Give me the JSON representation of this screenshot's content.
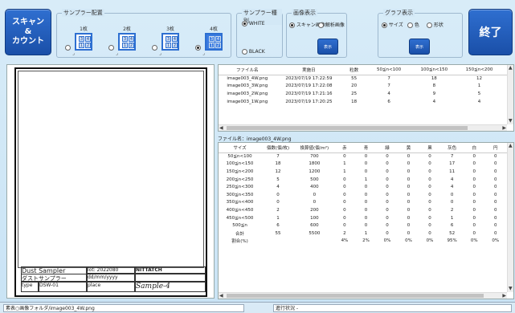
{
  "buttons": {
    "scan": "スキャン\n&\nカウント",
    "exit": "終了",
    "scan_image_view": "表示",
    "graph_view": "表示"
  },
  "sampler_group": {
    "title": "サンプラー配置",
    "options": [
      {
        "label": "1枚",
        "cells": [
          "3",
          "4",
          "1",
          "2"
        ],
        "selected": false
      },
      {
        "label": "2枚",
        "cells": [
          "3",
          "4",
          "1",
          "2"
        ],
        "selected": false
      },
      {
        "label": "3枚",
        "cells": [
          "3",
          "4",
          "1",
          "2"
        ],
        "selected": false
      },
      {
        "label": "4枚",
        "cells": [
          "3",
          "4",
          "1",
          "2"
        ],
        "selected": true
      }
    ],
    "corner_mark": "⌟"
  },
  "background_group": {
    "title": "サンプラー種別",
    "white": "WHITE",
    "black": "BLACK",
    "selected": "WHITE"
  },
  "image_view_group": {
    "title": "画像表示",
    "scan_image": "スキャン画像",
    "analysis_image": "解析画像",
    "selected": "スキャン画像"
  },
  "graph_group": {
    "title": "グラフ表示",
    "size": "サイズ",
    "color": "色",
    "shape": "形状",
    "selected": "サイズ"
  },
  "file_list": {
    "headers": [
      "ファイル名",
      "実施日",
      "粒数",
      "50≦n<100",
      "100≦n<150",
      "150≦n<200"
    ],
    "rows": [
      [
        "image003_4W.png",
        "2023/07/19 17:22:59",
        "55",
        "7",
        "18",
        "12"
      ],
      [
        "image003_3W.png",
        "2023/07/19 17:22:08",
        "20",
        "7",
        "8",
        "1"
      ],
      [
        "image003_2W.png",
        "2023/07/19 17:21:16",
        "25",
        "4",
        "9",
        "5"
      ],
      [
        "image003_1W.png",
        "2023/07/19 17:20:25",
        "18",
        "6",
        "4",
        "4"
      ]
    ]
  },
  "detail": {
    "file_label": "ファイル名：image003_4W.png",
    "headers": [
      "サイズ",
      "個数(個/枚)",
      "換算値(個/m²)",
      "赤",
      "青",
      "緑",
      "黄",
      "黒",
      "灰色",
      "白",
      "円"
    ],
    "rows": [
      [
        "50≦n<100",
        "7",
        "700",
        "0",
        "0",
        "0",
        "0",
        "0",
        "7",
        "0",
        "0"
      ],
      [
        "100≦n<150",
        "18",
        "1800",
        "1",
        "0",
        "0",
        "0",
        "0",
        "17",
        "0",
        "0"
      ],
      [
        "150≦n<200",
        "12",
        "1200",
        "1",
        "0",
        "0",
        "0",
        "0",
        "11",
        "0",
        "0"
      ],
      [
        "200≦n<250",
        "5",
        "500",
        "0",
        "1",
        "0",
        "0",
        "0",
        "4",
        "0",
        "0"
      ],
      [
        "250≦n<300",
        "4",
        "400",
        "0",
        "0",
        "0",
        "0",
        "0",
        "4",
        "0",
        "0"
      ],
      [
        "300≦n<350",
        "0",
        "0",
        "0",
        "0",
        "0",
        "0",
        "0",
        "0",
        "0",
        "0"
      ],
      [
        "350≦n<400",
        "0",
        "0",
        "0",
        "0",
        "0",
        "0",
        "0",
        "0",
        "0",
        "0"
      ],
      [
        "400≦n<450",
        "2",
        "200",
        "0",
        "0",
        "0",
        "0",
        "0",
        "2",
        "0",
        "0"
      ],
      [
        "450≦n<500",
        "1",
        "100",
        "0",
        "0",
        "0",
        "0",
        "0",
        "1",
        "0",
        "0"
      ],
      [
        "500≦n",
        "6",
        "600",
        "0",
        "0",
        "0",
        "0",
        "0",
        "6",
        "0",
        "0"
      ],
      [
        "合計",
        "55",
        "5500",
        "2",
        "1",
        "0",
        "0",
        "0",
        "52",
        "0",
        "0"
      ],
      [
        "割合(%)",
        "",
        "",
        "4%",
        "2%",
        "0%",
        "0%",
        "0%",
        "95%",
        "0%",
        "0%"
      ]
    ]
  },
  "sheet": {
    "title_en": "Dust Sampler",
    "title_jp": "ダストサンプラー",
    "lot_label": "lot:",
    "lot_value": "2022080",
    "brand": "NITTATCH",
    "date_placeholder": "dd/mm/yyyy",
    "type_label": "type",
    "type_value": "DSW-01",
    "place_label": "place",
    "handwritten": "Sample-4"
  },
  "status": {
    "path": "素表○画像フォルダ/image003_4W.png",
    "progress_label": "進行状況 -"
  },
  "colors": {
    "accent": "#1f5cc0",
    "selected_row": "#cce4f7"
  }
}
